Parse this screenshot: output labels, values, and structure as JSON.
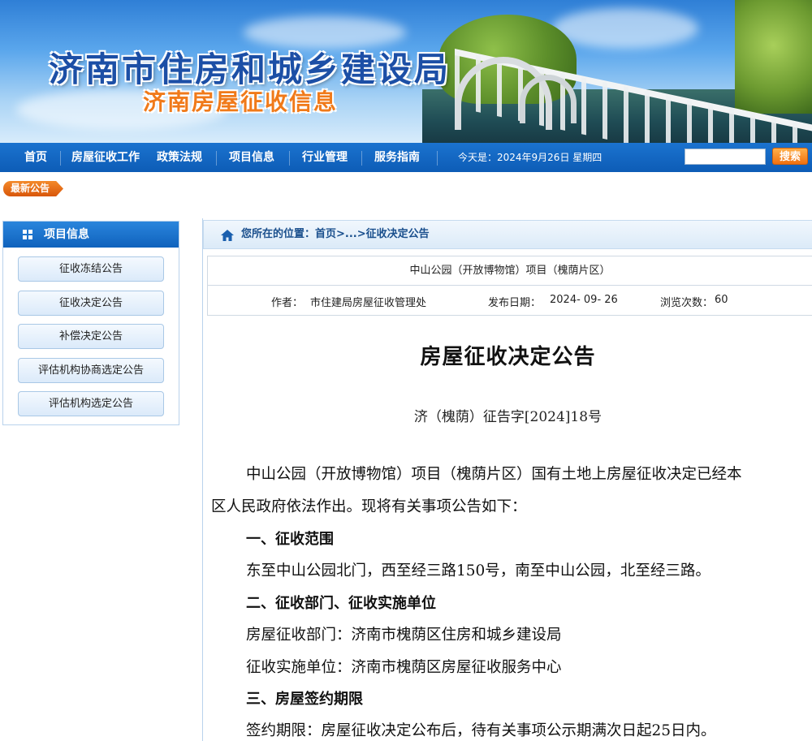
{
  "banner": {
    "title": "济南市住房和城乡建设局",
    "subtitle": "济南房屋征收信息"
  },
  "nav": {
    "items": [
      "首页",
      "房屋征收工作",
      "政策法规",
      "项目信息",
      "行业管理",
      "服务指南"
    ],
    "date_text": "今天是：2024年9月26日 星期四",
    "search_placeholder": "",
    "search_label": "搜索"
  },
  "notice_tag": "最新公告",
  "sidebar": {
    "title": "项目信息",
    "items": [
      "征收冻结公告",
      "征收决定公告",
      "补偿决定公告",
      "评估机构协商选定公告",
      "评估机构选定公告"
    ]
  },
  "breadcrumb": {
    "prefix": "您所在的位置：",
    "home": "首页",
    "sep": ">...>",
    "current": "征收决定公告"
  },
  "article": {
    "project": "中山公园（开放博物馆）项目（槐荫片区）",
    "author_label": "作者：",
    "author": "市住建局房屋征收管理处",
    "date_label": "发布日期：",
    "date": "2024- 09- 26",
    "views_label": "浏览次数：",
    "views": "60",
    "title": "房屋征收决定公告",
    "doc_no": "济（槐荫）征告字[2024]18号",
    "paragraphs": [
      "中山公园（开放博物馆）项目（槐荫片区）国有土地上房屋征收决定已经本",
      "区人民政府依法作出。现将有关事项公告如下：",
      "一、征收范围",
      "东至中山公园北门，西至经三路150号，南至中山公园，北至经三路。",
      "二、征收部门、征收实施单位",
      "房屋征收部门：济南市槐荫区住房和城乡建设局",
      "征收实施单位：济南市槐荫区房屋征收服务中心",
      "三、房屋签约期限",
      "签约期限：房屋征收决定公布后，待有关事项公示期满次日起25日内。"
    ]
  },
  "colors": {
    "nav_blue": "#0d5cb6",
    "accent_orange": "#f07010",
    "title_blue": "#1c4fa6"
  }
}
